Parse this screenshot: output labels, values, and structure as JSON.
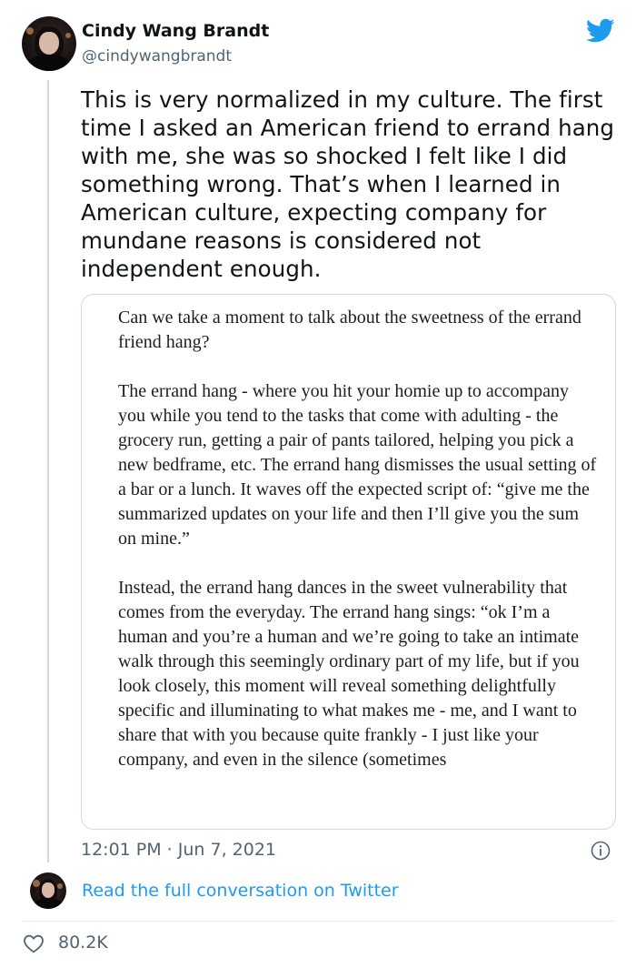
{
  "tweet": {
    "author_name": "Cindy Wang Brandt",
    "author_handle": "@cindywangbrandt",
    "text": "This is very normalized in my culture. The first time I asked an American friend to errand hang with me, she was so shocked I felt like I did something wrong. That’s when I learned in American culture, expecting company for mundane reasons is considered not independent enough.",
    "timestamp": "12:01 PM · Jun 7, 2021",
    "brand_icon": "twitter-bird-icon",
    "brand_color": "#1d9bf0"
  },
  "media": {
    "paragraphs": [
      "Can we take a moment to talk about the sweetness of the errand friend hang?",
      "The errand hang - where you hit your homie up to accompany you while you tend to the tasks that come with adulting - the grocery run, getting a pair of pants tailored, helping you pick a new bedframe, etc. The errand hang dismisses the usual setting of a bar or a lunch. It waves off the expected script of: “give me the summarized updates on your life and then I’ll give you the sum on mine.”",
      "Instead, the errand hang dances in the sweet vulnerability that comes from the everyday. The errand hang sings: “ok I’m a human and you’re a human and we’re going to take an intimate walk through this seemingly ordinary part of my life, but if you look closely, this moment will reveal something delightfully specific and illuminating to what makes me - me, and I want to share that with you because quite frankly - I just like your company, and even in the silence (sometimes"
    ]
  },
  "footer": {
    "read_more": "Read the full conversation on Twitter",
    "likes": "80.2K",
    "like_icon": "heart-icon",
    "info_icon": "info-icon"
  }
}
